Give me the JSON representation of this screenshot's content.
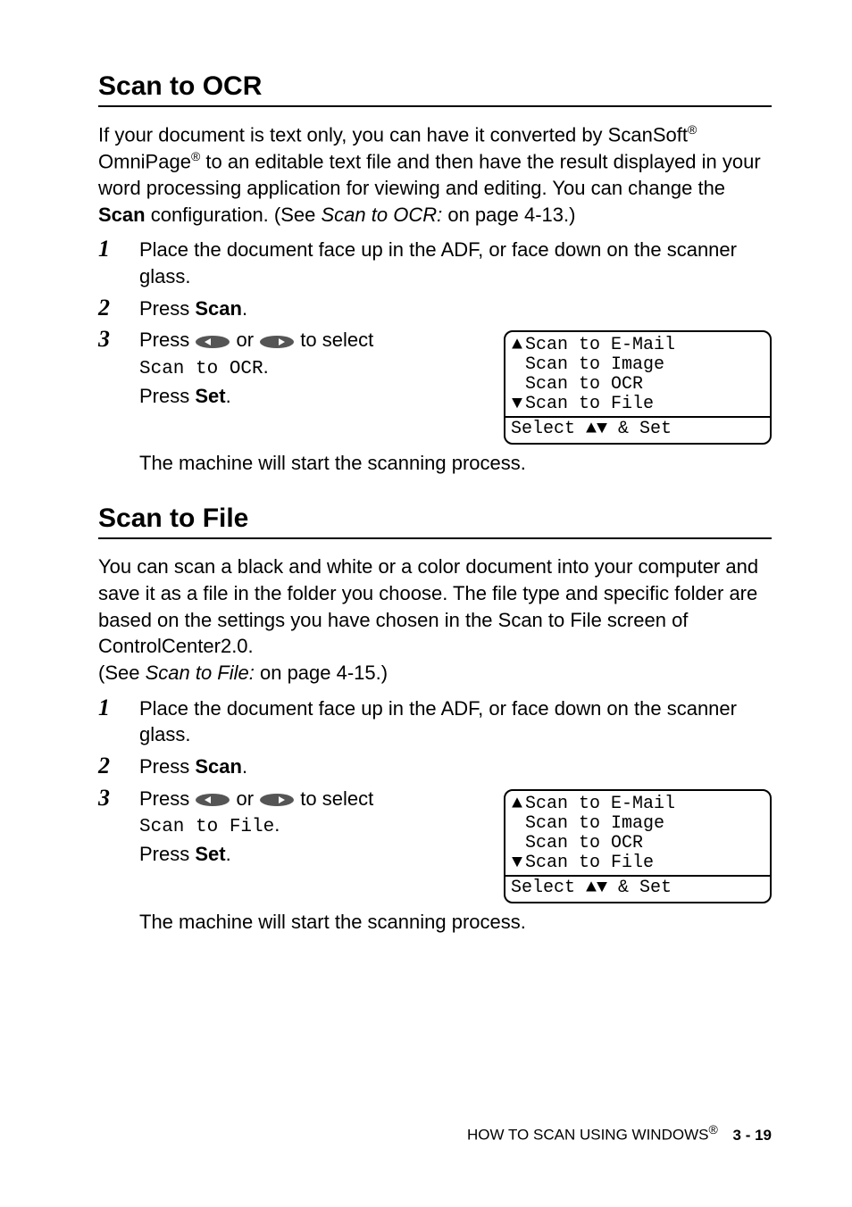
{
  "section1": {
    "heading": "Scan to OCR",
    "intro_parts": {
      "p1": "If your document is text only, you can have it converted by ScanSoft",
      "p2": " OmniPage",
      "p3": " to an editable text file and then have the result displayed in your word processing application for viewing and editing. You can change the ",
      "scan_bold": "Scan",
      "p4": " configuration. (See ",
      "ref": "Scan to OCR:",
      "p5": " on page 4-13.)"
    },
    "steps": {
      "s1": "Place the document face up in the ADF, or face down on the scanner glass.",
      "s2_a": "Press ",
      "s2_scan": "Scan",
      "s2_b": ".",
      "s3_a": "Press ",
      "s3_or": " or ",
      "s3_b": " to select",
      "s3_target": "Scan to OCR",
      "s3_c": ".",
      "s3_press": "Press ",
      "s3_set": "Set",
      "s3_d": ".",
      "s3_after": "The machine will start the scanning process."
    }
  },
  "section2": {
    "heading": "Scan to File",
    "intro_parts": {
      "p1": "You can scan a black and white or a color document into your computer and save it as a file in the folder you choose. The file type and specific folder are based on the settings you have chosen in the Scan to File screen of ControlCenter2.0.",
      "p2_a": "(See ",
      "ref": "Scan to File:",
      "p2_b": " on page 4-15.)"
    },
    "steps": {
      "s1": "Place the document face up in the ADF, or face down on the scanner glass.",
      "s2_a": "Press ",
      "s2_scan": "Scan",
      "s2_b": ".",
      "s3_a": "Press ",
      "s3_or": " or ",
      "s3_b": " to select",
      "s3_target": "Scan to File",
      "s3_c": ".",
      "s3_press": "Press ",
      "s3_set": "Set",
      "s3_d": ".",
      "s3_after": "The machine will start the scanning process."
    }
  },
  "lcd": {
    "l1": "Scan to E-Mail",
    "l2": "Scan to Image",
    "l3": "Scan to OCR",
    "l4": "Scan to File",
    "status_a": "Select ",
    "status_b": " & Set"
  },
  "footer": {
    "text": "HOW TO SCAN USING WINDOWS",
    "page": "3 - 19"
  },
  "glyphs": {
    "reg": "®",
    "up": "▲",
    "down": "▼"
  }
}
